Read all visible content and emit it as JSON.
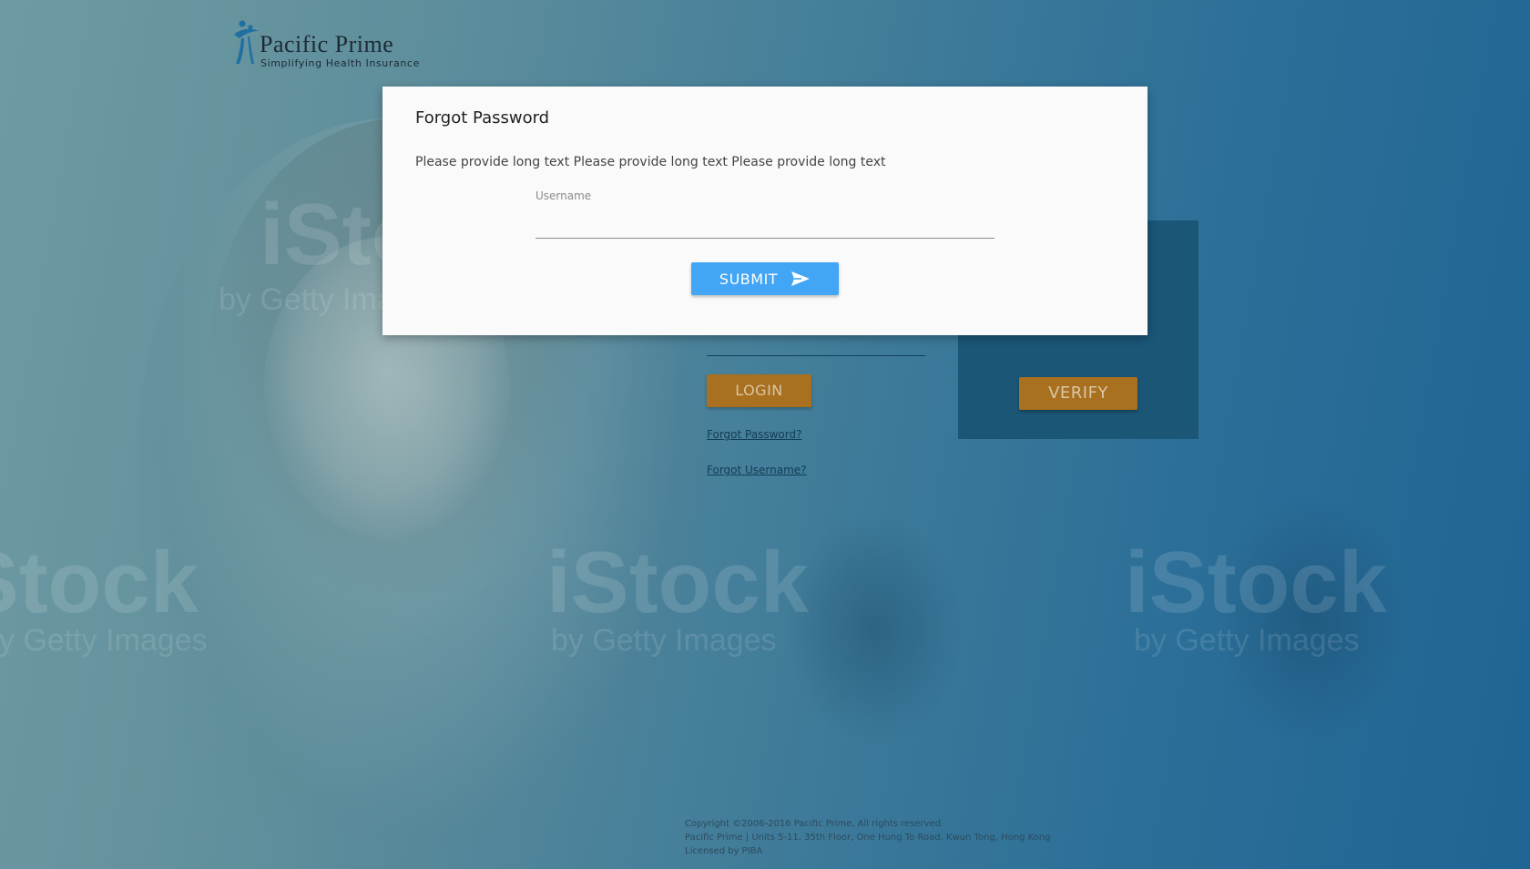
{
  "brand": {
    "name": "Pacific Prime",
    "tagline": "Simplifying Health Insurance"
  },
  "background": {
    "watermark_main": "iStock",
    "watermark_sub": "by Getty Images"
  },
  "login": {
    "login_label": "LOGIN",
    "forgot_password_label": "Forgot Password?",
    "forgot_username_label": "Forgot Username?",
    "verify_label": "VERIFY"
  },
  "dialog": {
    "title": "Forgot Password",
    "description": "Please provide long text Please provide long text Please provide long text",
    "username_label": "Username",
    "username_value": "",
    "submit_label": "SUBMIT"
  },
  "footer": {
    "copyright": "Copyright ©2006-2016 Pacific Prime, All rights reserved",
    "address": "Pacific Prime | Units 5-11, 35th Floor, One Hung To Road, Kwun Tong, Hong Kong",
    "license": "Licensed by PIBA"
  },
  "colors": {
    "accent_blue": "#42a5f5",
    "orange_button": "#a8701f",
    "overlay_blue": "#1f6594"
  }
}
